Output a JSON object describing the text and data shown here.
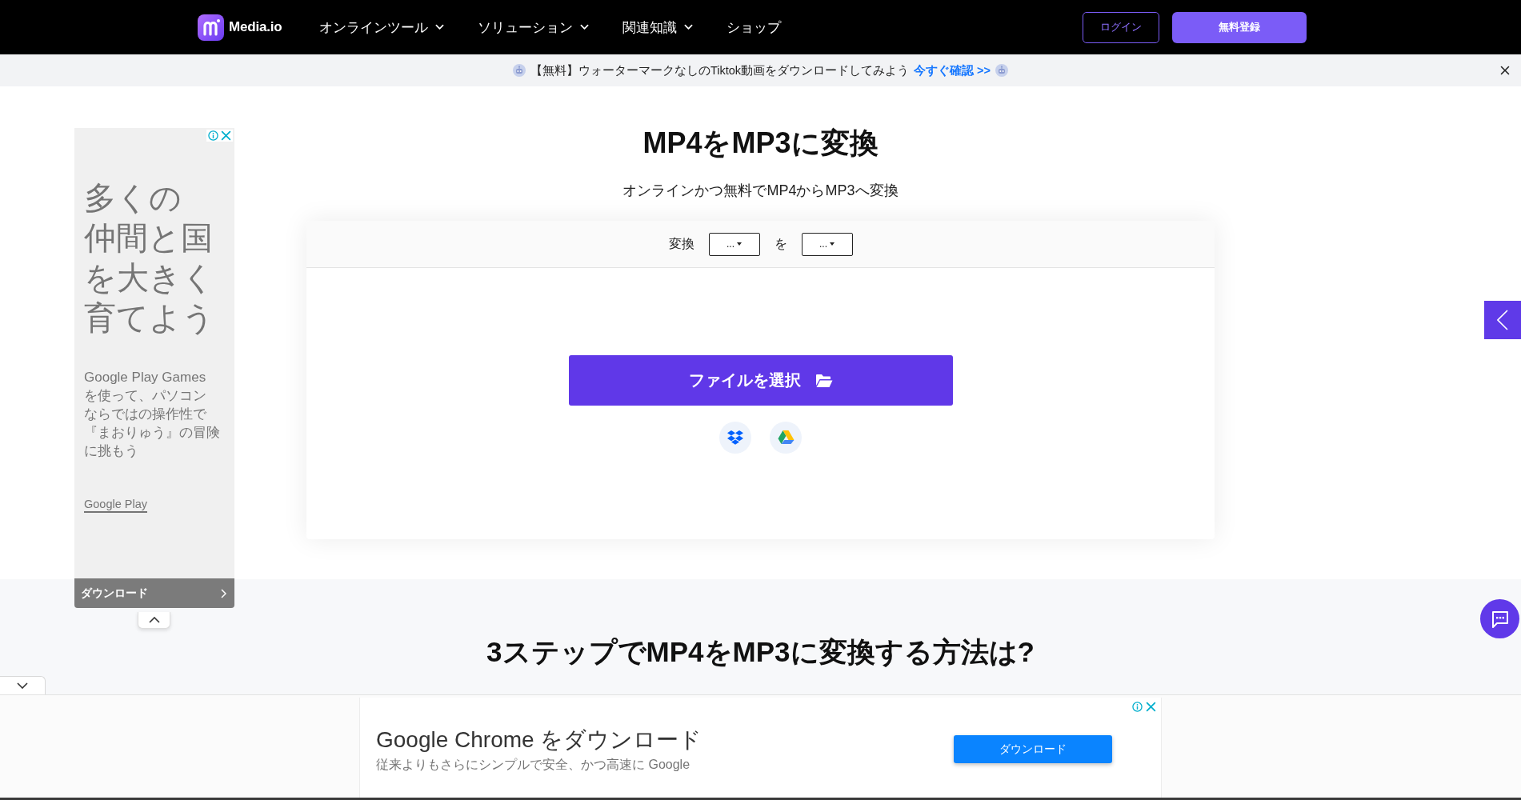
{
  "nav": {
    "brand": "Media.io",
    "menu": [
      {
        "label": "オンラインツール",
        "dropdown": true
      },
      {
        "label": "ソリューション",
        "dropdown": true
      },
      {
        "label": "関連知識",
        "dropdown": true
      },
      {
        "label": "ショップ",
        "dropdown": false
      }
    ],
    "login": "ログイン",
    "signup": "無料登録"
  },
  "banner": {
    "text": "【無料】ウォーターマークなしのTiktok動画をダウンロードしてみよう",
    "link": "今すぐ確認 >>"
  },
  "side_ad": {
    "headline_lines": [
      "多くの",
      "仲間と国",
      "を大きく",
      "育てよう"
    ],
    "body_lines": [
      "Google Play Games",
      "を使って、パソコン",
      "ならではの操作性で",
      "『まおりゅう』の冒険",
      "に挑もう"
    ],
    "source": "Google Play",
    "cta": "ダウンロード"
  },
  "converter": {
    "title": "MP4をMP3に変換",
    "subtitle": "オンラインかつ無料でMP4からMP3へ変換",
    "from_label": "変換",
    "from_value": "...",
    "to_label": "を",
    "to_value": "...",
    "upload_button": "ファイルを選択"
  },
  "how_to": {
    "heading": "3ステップでMP4をMP3に変換する方法は?"
  },
  "bottom_ad": {
    "title": "Google Chrome をダウンロード",
    "description": "従来よりもさらにシンプルで安全、かつ高速に Google",
    "cta": "ダウンロード"
  }
}
